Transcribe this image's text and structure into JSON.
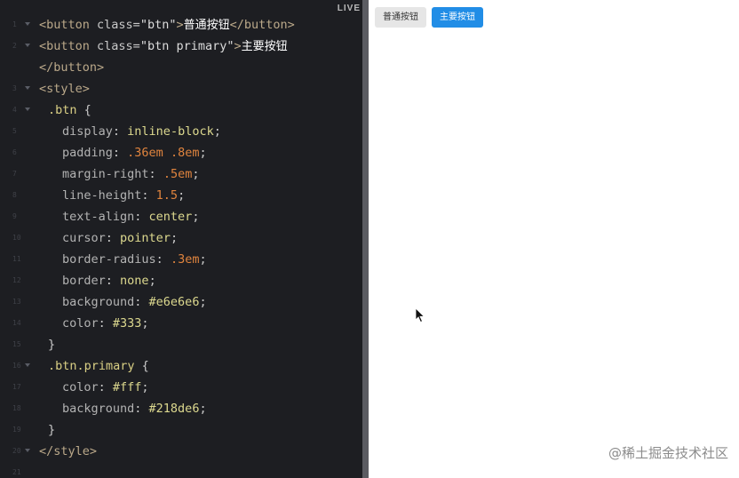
{
  "editor": {
    "live_label": "LIVE",
    "lines": [
      {
        "n": "1",
        "fold": true,
        "indent": 0,
        "tokens": [
          [
            "tag",
            "<button "
          ],
          [
            "attr",
            "class"
          ],
          [
            "pun",
            "="
          ],
          [
            "str",
            "\"btn\""
          ],
          [
            "tag",
            ">"
          ],
          [
            "txt",
            "普通按钮"
          ],
          [
            "tag",
            "</button>"
          ]
        ]
      },
      {
        "n": "2",
        "fold": true,
        "indent": 0,
        "tokens": [
          [
            "tag",
            "<button "
          ],
          [
            "attr",
            "class"
          ],
          [
            "pun",
            "="
          ],
          [
            "str",
            "\"btn primary\""
          ],
          [
            "tag",
            ">"
          ],
          [
            "txt",
            "主要按钮"
          ]
        ]
      },
      {
        "n": "",
        "fold": false,
        "indent": 0,
        "tokens": [
          [
            "tag",
            "</button>"
          ]
        ]
      },
      {
        "n": "3",
        "fold": true,
        "indent": 0,
        "tokens": [
          [
            "tag",
            "<style>"
          ]
        ]
      },
      {
        "n": "4",
        "fold": true,
        "indent": 1,
        "tokens": [
          [
            "sel",
            ".btn "
          ],
          [
            "pun",
            "{"
          ]
        ]
      },
      {
        "n": "5",
        "fold": false,
        "indent": 2,
        "tokens": [
          [
            "prop",
            "display"
          ],
          [
            "pun",
            ": "
          ],
          [
            "val",
            "inline-block"
          ],
          [
            "pun",
            ";"
          ]
        ]
      },
      {
        "n": "6",
        "fold": false,
        "indent": 2,
        "tokens": [
          [
            "prop",
            "padding"
          ],
          [
            "pun",
            ": "
          ],
          [
            "num-val",
            ".36em .8em"
          ],
          [
            "pun",
            ";"
          ]
        ]
      },
      {
        "n": "7",
        "fold": false,
        "indent": 2,
        "tokens": [
          [
            "prop",
            "margin-right"
          ],
          [
            "pun",
            ": "
          ],
          [
            "num-val",
            ".5em"
          ],
          [
            "pun",
            ";"
          ]
        ]
      },
      {
        "n": "8",
        "fold": false,
        "indent": 2,
        "tokens": [
          [
            "prop",
            "line-height"
          ],
          [
            "pun",
            ": "
          ],
          [
            "num-val",
            "1.5"
          ],
          [
            "pun",
            ";"
          ]
        ]
      },
      {
        "n": "9",
        "fold": false,
        "indent": 2,
        "tokens": [
          [
            "prop",
            "text-align"
          ],
          [
            "pun",
            ": "
          ],
          [
            "val",
            "center"
          ],
          [
            "pun",
            ";"
          ]
        ]
      },
      {
        "n": "10",
        "fold": false,
        "indent": 2,
        "tokens": [
          [
            "prop",
            "cursor"
          ],
          [
            "pun",
            ": "
          ],
          [
            "val",
            "pointer"
          ],
          [
            "pun",
            ";"
          ]
        ]
      },
      {
        "n": "11",
        "fold": false,
        "indent": 2,
        "tokens": [
          [
            "prop",
            "border-radius"
          ],
          [
            "pun",
            ": "
          ],
          [
            "num-val",
            ".3em"
          ],
          [
            "pun",
            ";"
          ]
        ]
      },
      {
        "n": "12",
        "fold": false,
        "indent": 2,
        "tokens": [
          [
            "prop",
            "border"
          ],
          [
            "pun",
            ": "
          ],
          [
            "val",
            "none"
          ],
          [
            "pun",
            ";"
          ]
        ]
      },
      {
        "n": "13",
        "fold": false,
        "indent": 2,
        "tokens": [
          [
            "prop",
            "background"
          ],
          [
            "pun",
            ": "
          ],
          [
            "val",
            "#e6e6e6"
          ],
          [
            "pun",
            ";"
          ]
        ]
      },
      {
        "n": "14",
        "fold": false,
        "indent": 2,
        "tokens": [
          [
            "prop",
            "color"
          ],
          [
            "pun",
            ": "
          ],
          [
            "val",
            "#333"
          ],
          [
            "pun",
            ";"
          ]
        ]
      },
      {
        "n": "15",
        "fold": false,
        "indent": 1,
        "tokens": [
          [
            "pun",
            "}"
          ]
        ]
      },
      {
        "n": "16",
        "fold": true,
        "indent": 1,
        "tokens": [
          [
            "sel",
            ".btn.primary "
          ],
          [
            "pun",
            "{"
          ]
        ]
      },
      {
        "n": "17",
        "fold": false,
        "indent": 2,
        "tokens": [
          [
            "prop",
            "color"
          ],
          [
            "pun",
            ": "
          ],
          [
            "val",
            "#fff"
          ],
          [
            "pun",
            ";"
          ]
        ]
      },
      {
        "n": "18",
        "fold": false,
        "indent": 2,
        "tokens": [
          [
            "prop",
            "background"
          ],
          [
            "pun",
            ": "
          ],
          [
            "val",
            "#218de6"
          ],
          [
            "pun",
            ";"
          ]
        ]
      },
      {
        "n": "19",
        "fold": false,
        "indent": 1,
        "tokens": [
          [
            "pun",
            "}"
          ]
        ]
      },
      {
        "n": "20",
        "fold": true,
        "indent": 0,
        "tokens": [
          [
            "tag",
            "</style>"
          ]
        ]
      },
      {
        "n": "21",
        "fold": false,
        "indent": 0,
        "tokens": []
      }
    ]
  },
  "preview": {
    "normal_button_label": "普通按钮",
    "primary_button_label": "主要按钮",
    "normal_button_bg": "#e6e6e6",
    "normal_button_color": "#333333",
    "primary_button_bg": "#218de6",
    "primary_button_color": "#ffffff",
    "cursor_icon": "mouse-pointer-icon"
  },
  "watermark": "@稀土掘金技术社区"
}
